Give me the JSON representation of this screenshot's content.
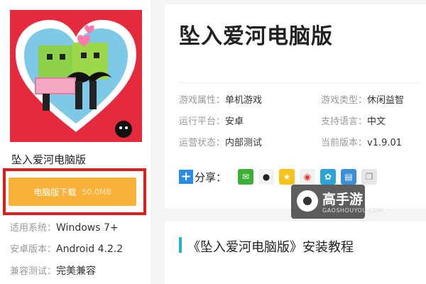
{
  "app": {
    "name": "坠入爱河电脑版",
    "title": "坠入爱河电脑版"
  },
  "download": {
    "label": "电脑版下载",
    "size": "50.0MB"
  },
  "sidebar_info": [
    {
      "label": "适用系统：",
      "value": "Windows 7+"
    },
    {
      "label": "安卓版本：",
      "value": "Android 4.2.2"
    },
    {
      "label": "兼容测试：",
      "value": "完美兼容"
    }
  ],
  "meta": [
    {
      "label": "游戏属性：",
      "value": "单机游戏"
    },
    {
      "label": "游戏类型：",
      "value": "休闲益智"
    },
    {
      "label": "运行平台：",
      "value": "安卓"
    },
    {
      "label": "支持语言：",
      "value": "中文"
    },
    {
      "label": "运营状态：",
      "value": "内部测试"
    },
    {
      "label": "当前版本：",
      "value": "v1.9.01"
    }
  ],
  "share": {
    "label": "分享：",
    "icons": [
      "wechat-icon",
      "qq-icon",
      "qzone-icon",
      "weibo-icon",
      "tencent-weibo-icon",
      "print-icon",
      "copy-icon"
    ]
  },
  "watermark": {
    "brand": "高手游",
    "url": "GAOSHOUYOU.COM"
  },
  "tutorial": {
    "heading": "《坠入爱河电脑版》安装教程"
  }
}
